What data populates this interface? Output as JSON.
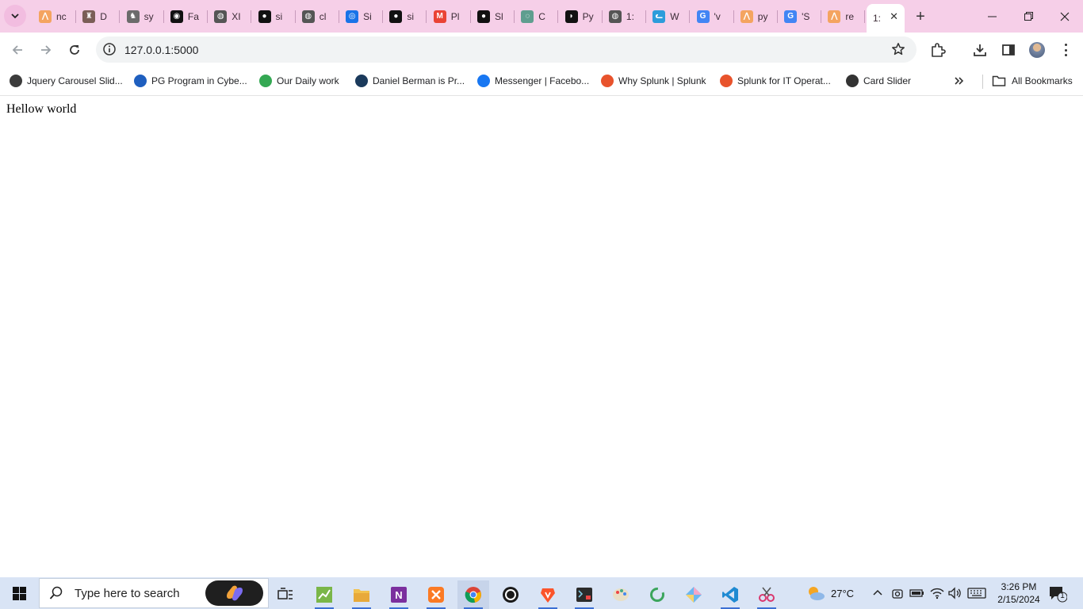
{
  "browser": {
    "tabs": [
      {
        "title": "nc",
        "color": "#f4a460",
        "glyph": "⋀"
      },
      {
        "title": "D",
        "color": "#7b5e57",
        "glyph": "♜"
      },
      {
        "title": "sy",
        "color": "#6b6b6b",
        "glyph": "♞"
      },
      {
        "title": "Fa",
        "color": "#111111",
        "glyph": "◉"
      },
      {
        "title": "XI",
        "color": "#555555",
        "glyph": "◍"
      },
      {
        "title": "si",
        "color": "#111111",
        "glyph": "●"
      },
      {
        "title": "cl",
        "color": "#555555",
        "glyph": "◍"
      },
      {
        "title": "Si",
        "color": "#1a73e8",
        "glyph": "◎"
      },
      {
        "title": "si",
        "color": "#111111",
        "glyph": "●"
      },
      {
        "title": "Pl",
        "color": "#ea4335",
        "glyph": "M"
      },
      {
        "title": "Sl",
        "color": "#111111",
        "glyph": "●"
      },
      {
        "title": "C",
        "color": "#5f9e8f",
        "glyph": "◌"
      },
      {
        "title": "Py",
        "color": "#111111",
        "glyph": "◗"
      },
      {
        "title": "1:",
        "color": "#555555",
        "glyph": "◍"
      },
      {
        "title": "W",
        "color": "#2d9cdb",
        "glyph": "ᓚ"
      },
      {
        "title": "'v",
        "color": "#4285f4",
        "glyph": "G"
      },
      {
        "title": "py",
        "color": "#f4a460",
        "glyph": "⋀"
      },
      {
        "title": "'S",
        "color": "#4285f4",
        "glyph": "G"
      },
      {
        "title": "re",
        "color": "#f4a460",
        "glyph": "⋀"
      }
    ],
    "active_tab": {
      "title": "1:"
    },
    "url": "127.0.0.1:5000"
  },
  "bookmarks": [
    {
      "label": "Jquery Carousel Slid...",
      "color": "#3c3c3c"
    },
    {
      "label": "PG Program in Cybe...",
      "color": "#1f5fbf"
    },
    {
      "label": "Our Daily work",
      "color": "#34a853"
    },
    {
      "label": "Daniel Berman is Pr...",
      "color": "#1b3a5c"
    },
    {
      "label": "Messenger | Facebo...",
      "color": "#1877f2"
    },
    {
      "label": "Why Splunk | Splunk",
      "color": "#e8532c"
    },
    {
      "label": "Splunk for IT Operat...",
      "color": "#e8532c"
    },
    {
      "label": "Card Slider",
      "color": "#333333"
    }
  ],
  "all_bookmarks_label": "All Bookmarks",
  "page": {
    "text": "Hellow world"
  },
  "taskbar": {
    "search_placeholder": "Type here to search",
    "weather": "27°C",
    "time": "3:26 PM",
    "date": "2/15/2024",
    "notification_count": "1"
  }
}
